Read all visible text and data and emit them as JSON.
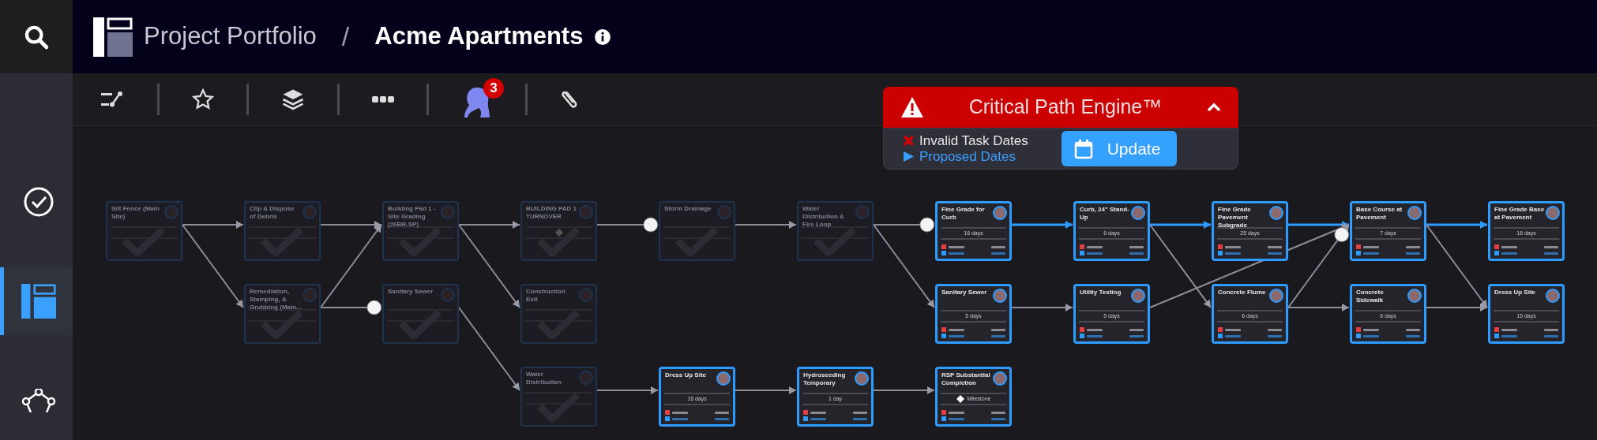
{
  "header": {
    "section": "Project Portfolio",
    "separator": "/",
    "project": "Acme Apartments"
  },
  "sidebar": {
    "items": [
      {
        "selected": false
      },
      {
        "selected": true
      },
      {
        "selected": false
      }
    ]
  },
  "toolbar": {
    "notification_count": "3"
  },
  "critical_path": {
    "title": "Critical Path Engine™",
    "expanded": true,
    "legend": [
      {
        "kind": "invalid",
        "label": "Invalid Task Dates"
      },
      {
        "kind": "proposed",
        "label": "Proposed Dates"
      }
    ],
    "button": "Update"
  },
  "nodes": [
    {
      "title": "Silt Fence (Main Site)",
      "kind": "task",
      "faded": true
    },
    {
      "title": "Clip & Dispose of Debris",
      "kind": "task",
      "faded": true
    },
    {
      "title": "Building Pad 1 - Site Grading (26BR-SP)",
      "kind": "task",
      "faded": true
    },
    {
      "title": "BUILDING PAD 1 TURNOVER",
      "kind": "milestone",
      "faded": true
    },
    {
      "title": "Storm Drainage",
      "kind": "task",
      "faded": true
    },
    {
      "title": "Water Distribution & Fire Loop",
      "kind": "task",
      "faded": true
    },
    {
      "title": "Fine Grade for Curb",
      "kind": "task",
      "faded": false,
      "duration": "16 days"
    },
    {
      "title": "Curb, 24\" Stand-Up",
      "kind": "task",
      "faded": false,
      "duration": "6 days"
    },
    {
      "title": "Fine Grade Pavement Subgrade",
      "kind": "task",
      "faded": false,
      "duration": "25 days"
    },
    {
      "title": "Base Course at Pavement",
      "kind": "task",
      "faded": false,
      "duration": "7 days"
    },
    {
      "title": "Fine Grade Base at Pavement",
      "kind": "task",
      "faded": false,
      "duration": "16 days"
    },
    {
      "title": "Remediation, Stamping, & Grubbing (Main...",
      "kind": "task",
      "faded": true
    },
    {
      "title": "Sanitary Sewer",
      "kind": "task",
      "faded": true
    },
    {
      "title": "Construction Exit",
      "kind": "task",
      "faded": true
    },
    {
      "title": "Sanitary Sewer",
      "kind": "task",
      "faded": false,
      "duration": "5 days"
    },
    {
      "title": "Utility Testing",
      "kind": "task",
      "faded": false,
      "duration": "5 days"
    },
    {
      "title": "Concrete Flume",
      "kind": "task",
      "faded": false,
      "duration": "6 days"
    },
    {
      "title": "Concrete Sidewalk",
      "kind": "task",
      "faded": false,
      "duration": "6 days"
    },
    {
      "title": "Dress Up Site",
      "kind": "task",
      "faded": false,
      "duration": "15 days"
    },
    {
      "title": "Water Distribution",
      "kind": "task",
      "faded": true
    },
    {
      "title": "Dress Up Site",
      "kind": "task",
      "faded": false,
      "duration": "16 days"
    },
    {
      "title": "Hydroseeding Temporary",
      "kind": "task",
      "faded": false,
      "duration": "1 day"
    },
    {
      "title": "RSP Substantial Completion",
      "kind": "milestone",
      "faded": false,
      "duration": "Milestone"
    }
  ],
  "edges": [
    {
      "critical": false,
      "lag": false
    },
    {
      "critical": false,
      "lag": false
    },
    {
      "critical": false,
      "lag": false
    },
    {
      "critical": false,
      "lag": false
    },
    {
      "critical": false,
      "lag": true
    },
    {
      "critical": false,
      "lag": false
    },
    {
      "critical": false,
      "lag": true
    },
    {
      "critical": false,
      "lag": false
    },
    {
      "critical": false,
      "lag": false
    },
    {
      "critical": false,
      "lag": true
    },
    {
      "critical": false,
      "lag": false
    },
    {
      "critical": false,
      "lag": false
    },
    {
      "critical": false,
      "lag": false
    },
    {
      "critical": false,
      "lag": false
    },
    {
      "critical": false,
      "lag": false
    },
    {
      "critical": true,
      "lag": false
    },
    {
      "critical": true,
      "lag": false
    },
    {
      "critical": true,
      "lag": false
    },
    {
      "critical": true,
      "lag": false
    },
    {
      "critical": false,
      "lag": false
    },
    {
      "critical": false,
      "lag": false
    },
    {
      "critical": false,
      "lag": false
    },
    {
      "critical": false,
      "lag": false
    },
    {
      "critical": false,
      "lag": true
    },
    {
      "critical": false,
      "lag": false
    },
    {
      "critical": false,
      "lag": false
    }
  ]
}
